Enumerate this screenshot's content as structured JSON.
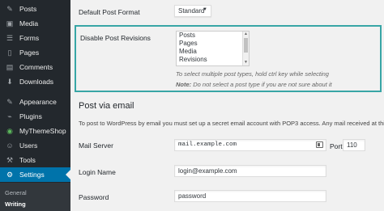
{
  "sidebar": {
    "items": [
      {
        "label": "Posts",
        "icon": "pin-icon",
        "glyph": "📌"
      },
      {
        "label": "Media",
        "icon": "media-icon",
        "glyph": "▣"
      },
      {
        "label": "Forms",
        "icon": "forms-icon",
        "glyph": "☰"
      },
      {
        "label": "Pages",
        "icon": "pages-icon",
        "glyph": "▯"
      },
      {
        "label": "Comments",
        "icon": "comments-icon",
        "glyph": "▤"
      },
      {
        "label": "Downloads",
        "icon": "downloads-icon",
        "glyph": "⬇"
      },
      {
        "label": "Appearance",
        "icon": "brush-icon",
        "glyph": "✎"
      },
      {
        "label": "Plugins",
        "icon": "plug-icon",
        "glyph": "⎇"
      },
      {
        "label": "MyThemeShop",
        "icon": "mythemeshop-icon",
        "glyph": "◉"
      },
      {
        "label": "Users",
        "icon": "user-icon",
        "glyph": "☺"
      },
      {
        "label": "Tools",
        "icon": "wrench-icon",
        "glyph": "⚒"
      },
      {
        "label": "Settings",
        "icon": "settings-icon",
        "glyph": "⚙"
      }
    ],
    "submenu": [
      "General",
      "Writing"
    ]
  },
  "main": {
    "default_format_label": "Default Post Format",
    "default_format_value": "Standard",
    "revisions_label": "Disable Post Revisions",
    "revisions_options": [
      "Posts",
      "Pages",
      "Media",
      "Revisions"
    ],
    "revisions_help1": "To select multiple post types, hold ctrl key while selecting",
    "revisions_note_bold": "Note:",
    "revisions_note_rest": " Do not select a post type if you are not sure about it",
    "post_via_email_title": "Post via email",
    "post_via_email_desc": "To post to WordPress by email you must set up a secret email account with POP3 access. Any mail received at this address",
    "mail_server_label": "Mail Server",
    "mail_server_value": "mail.example.com",
    "port_label": "Port",
    "port_value": "110",
    "login_name_label": "Login Name",
    "login_name_value": "login@example.com",
    "password_label": "Password",
    "password_value": "password"
  },
  "colors": {
    "sidebar_bg": "#23282d",
    "active_bg": "#0073aa",
    "highlight_border": "#38a6a6"
  }
}
